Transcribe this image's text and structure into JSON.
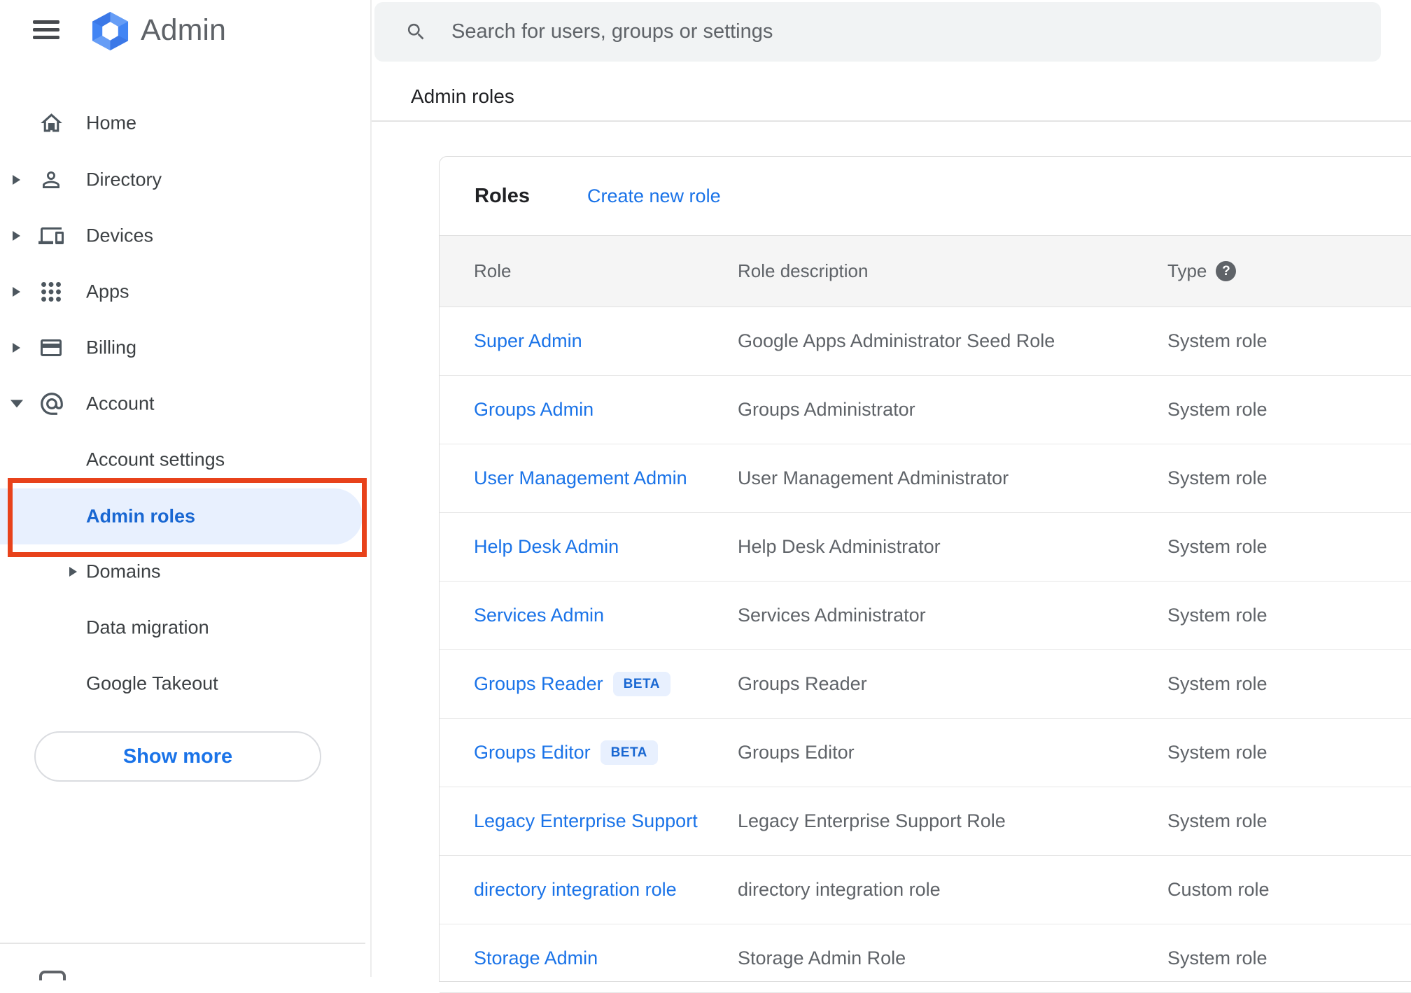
{
  "header": {
    "product_name": "Admin",
    "search_placeholder": "Search for users, groups or settings",
    "breadcrumb": "Admin roles"
  },
  "sidebar": {
    "items": [
      {
        "label": "Home",
        "icon": "home-icon",
        "expandable": false
      },
      {
        "label": "Directory",
        "icon": "person-icon",
        "expandable": true
      },
      {
        "label": "Devices",
        "icon": "devices-icon",
        "expandable": true
      },
      {
        "label": "Apps",
        "icon": "apps-grid-icon",
        "expandable": true
      },
      {
        "label": "Billing",
        "icon": "credit-card-icon",
        "expandable": true
      },
      {
        "label": "Account",
        "icon": "at-sign-icon",
        "expandable": true,
        "expanded": true
      }
    ],
    "account_children": [
      {
        "label": "Account settings",
        "active": false
      },
      {
        "label": "Admin roles",
        "active": true,
        "annotated": true
      },
      {
        "label": "Domains",
        "expandable": true
      },
      {
        "label": "Data migration"
      },
      {
        "label": "Google Takeout"
      }
    ],
    "show_more_label": "Show more"
  },
  "main": {
    "card_title": "Roles",
    "create_role_label": "Create new role",
    "table": {
      "headers": {
        "role": "Role",
        "description": "Role description",
        "type": "Type",
        "type_help_glyph": "?"
      },
      "rows": [
        {
          "role": "Super Admin",
          "description": "Google Apps Administrator Seed Role",
          "type": "System role"
        },
        {
          "role": "Groups Admin",
          "description": "Groups Administrator",
          "type": "System role"
        },
        {
          "role": "User Management Admin",
          "description": "User Management Administrator",
          "type": "System role"
        },
        {
          "role": "Help Desk Admin",
          "description": "Help Desk Administrator",
          "type": "System role"
        },
        {
          "role": "Services Admin",
          "description": "Services Administrator",
          "type": "System role"
        },
        {
          "role": "Groups Reader",
          "badge": "BETA",
          "description": "Groups Reader",
          "type": "System role"
        },
        {
          "role": "Groups Editor",
          "badge": "BETA",
          "description": "Groups Editor",
          "type": "System role"
        },
        {
          "role": "Legacy Enterprise Support",
          "description": "Legacy Enterprise Support Role",
          "type": "System role"
        },
        {
          "role": "directory integration role",
          "description": "directory integration role",
          "type": "Custom role"
        },
        {
          "role": "Storage Admin",
          "description": "Storage Admin Role",
          "type": "System role"
        }
      ]
    }
  },
  "colors": {
    "link_blue": "#1a73e8",
    "active_blue": "#1967d2",
    "selected_bg": "#e8f0fe",
    "annotation_red": "#e8421b",
    "badge_bg": "#e8f0fe",
    "badge_text": "#1967d2",
    "table_header_bg": "#f5f5f5"
  }
}
